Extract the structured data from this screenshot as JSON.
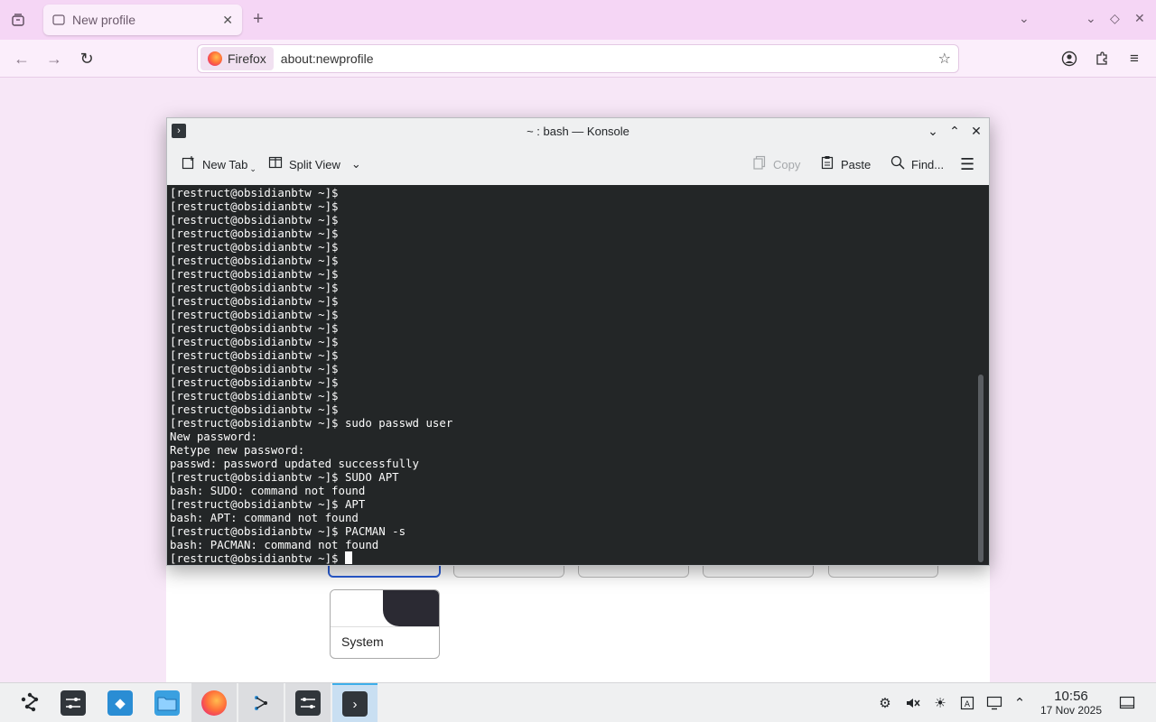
{
  "browser": {
    "tab_title": "New profile",
    "identity_label": "Firefox",
    "url": "about:newprofile"
  },
  "background_page": {
    "system_label": "System"
  },
  "konsole": {
    "title": "~ : bash — Konsole",
    "toolbar": {
      "new_tab": "New Tab",
      "split_view": "Split View",
      "copy": "Copy",
      "paste": "Paste",
      "find": "Find..."
    },
    "terminal_lines": [
      "[restruct@obsidianbtw ~]$",
      "[restruct@obsidianbtw ~]$",
      "[restruct@obsidianbtw ~]$",
      "[restruct@obsidianbtw ~]$",
      "[restruct@obsidianbtw ~]$",
      "[restruct@obsidianbtw ~]$",
      "[restruct@obsidianbtw ~]$",
      "[restruct@obsidianbtw ~]$",
      "[restruct@obsidianbtw ~]$",
      "[restruct@obsidianbtw ~]$",
      "[restruct@obsidianbtw ~]$",
      "[restruct@obsidianbtw ~]$",
      "[restruct@obsidianbtw ~]$",
      "[restruct@obsidianbtw ~]$",
      "[restruct@obsidianbtw ~]$",
      "[restruct@obsidianbtw ~]$",
      "[restruct@obsidianbtw ~]$",
      "[restruct@obsidianbtw ~]$ sudo passwd user",
      "New password:",
      "Retype new password:",
      "passwd: password updated successfully",
      "[restruct@obsidianbtw ~]$ SUDO APT",
      "bash: SUDO: command not found",
      "[restruct@obsidianbtw ~]$ APT",
      "bash: APT: command not found",
      "[restruct@obsidianbtw ~]$ PACMAN -s",
      "bash: PACMAN: command not found"
    ],
    "prompt": "[restruct@obsidianbtw ~]$ "
  },
  "taskbar": {
    "time": "10:56",
    "date": "17 Nov 2025"
  },
  "colors": {
    "terminal_bg": "#232627",
    "accent": "#3daee9",
    "browser_tint": "#f5d6f5"
  }
}
